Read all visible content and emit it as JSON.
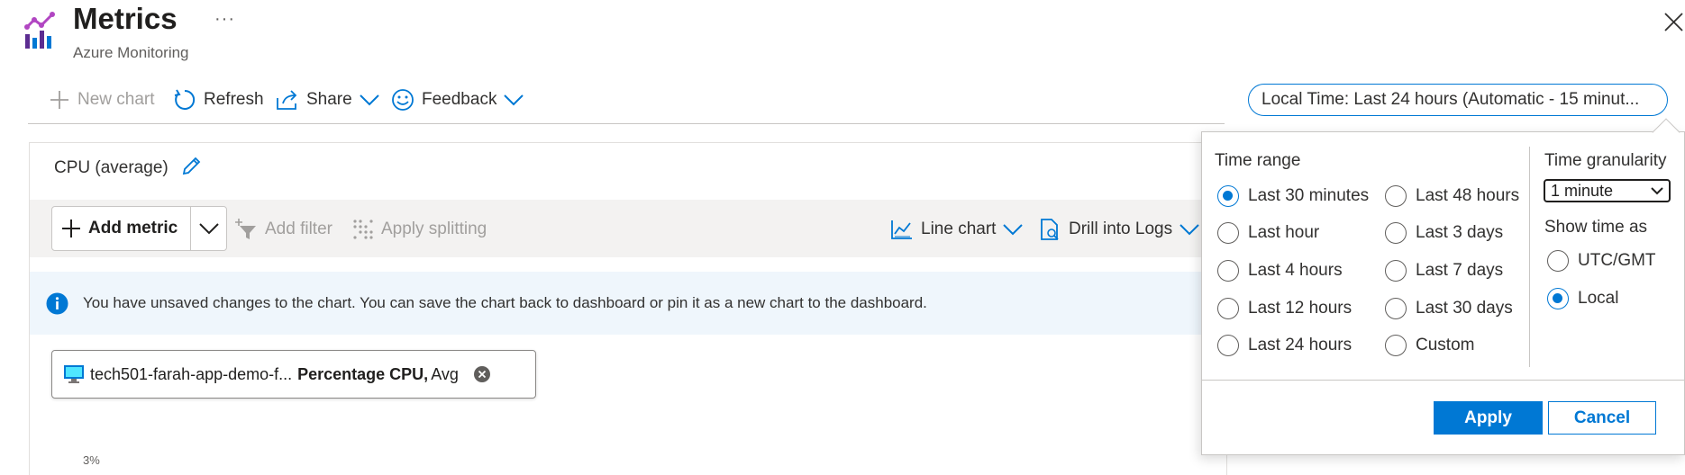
{
  "header": {
    "title": "Metrics",
    "subtitle": "Azure Monitoring",
    "more_glyph": "···"
  },
  "toolbar": {
    "new_chart": "New chart",
    "refresh": "Refresh",
    "share": "Share",
    "feedback": "Feedback",
    "time_picker": "Local Time: Last 24 hours (Automatic - 15 minut..."
  },
  "chart": {
    "title": "CPU (average)",
    "add_metric": "Add metric",
    "add_filter": "Add filter",
    "apply_splitting": "Apply splitting",
    "chart_type": "Line chart",
    "drill_logs": "Drill into Logs",
    "info_message": "You have unsaved changes to the chart. You can save the chart back to dashboard or pin it as a new chart to the dashboard.",
    "pill": {
      "resource": "tech501-farah-app-demo-f...",
      "metric": "Percentage CPU,",
      "aggregation": "Avg"
    },
    "y_tick": "3%"
  },
  "time_popup": {
    "time_range_heading": "Time range",
    "ranges_left": [
      "Last 30 minutes",
      "Last hour",
      "Last 4 hours",
      "Last 12 hours",
      "Last 24 hours"
    ],
    "ranges_right": [
      "Last 48 hours",
      "Last 3 days",
      "Last 7 days",
      "Last 30 days",
      "Custom"
    ],
    "selected_range": "Last 30 minutes",
    "granularity_heading": "Time granularity",
    "granularity_value": "1 minute",
    "show_time_heading": "Show time as",
    "time_options": [
      "UTC/GMT",
      "Local"
    ],
    "selected_time_option": "Local",
    "apply": "Apply",
    "cancel": "Cancel"
  },
  "colors": {
    "accent": "#0078d4",
    "info_bg": "#eff6fc",
    "toolbar_bg": "#f3f2f1"
  }
}
